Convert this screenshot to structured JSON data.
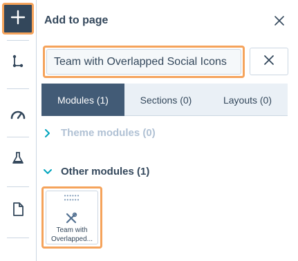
{
  "rail": {
    "items": [
      {
        "name": "add",
        "icon": "plus-icon",
        "active": true
      },
      {
        "name": "structure",
        "icon": "tree-icon"
      },
      {
        "name": "optimize",
        "icon": "speedometer-icon"
      },
      {
        "name": "test",
        "icon": "flask-icon"
      },
      {
        "name": "page",
        "icon": "document-icon"
      }
    ]
  },
  "panel": {
    "title": "Add to page",
    "close_icon": "close-icon"
  },
  "search": {
    "value": "Team with Overlapped Social Icons",
    "clear_icon": "close-icon"
  },
  "tabs": [
    {
      "label": "Modules (1)",
      "active": true
    },
    {
      "label": "Sections (0)",
      "active": false
    },
    {
      "label": "Layouts (0)",
      "active": false
    }
  ],
  "groups": {
    "theme": {
      "label": "Theme modules (0)",
      "expanded": false
    },
    "other": {
      "label": "Other modules (1)",
      "expanded": true
    }
  },
  "module_card": {
    "label": "Team with Overlapped...",
    "icon": "tools-icon"
  },
  "colors": {
    "accent_outline": "#f5a35b",
    "primary": "#33475b",
    "tab_active": "#425b76",
    "teal": "#00a4bd"
  }
}
